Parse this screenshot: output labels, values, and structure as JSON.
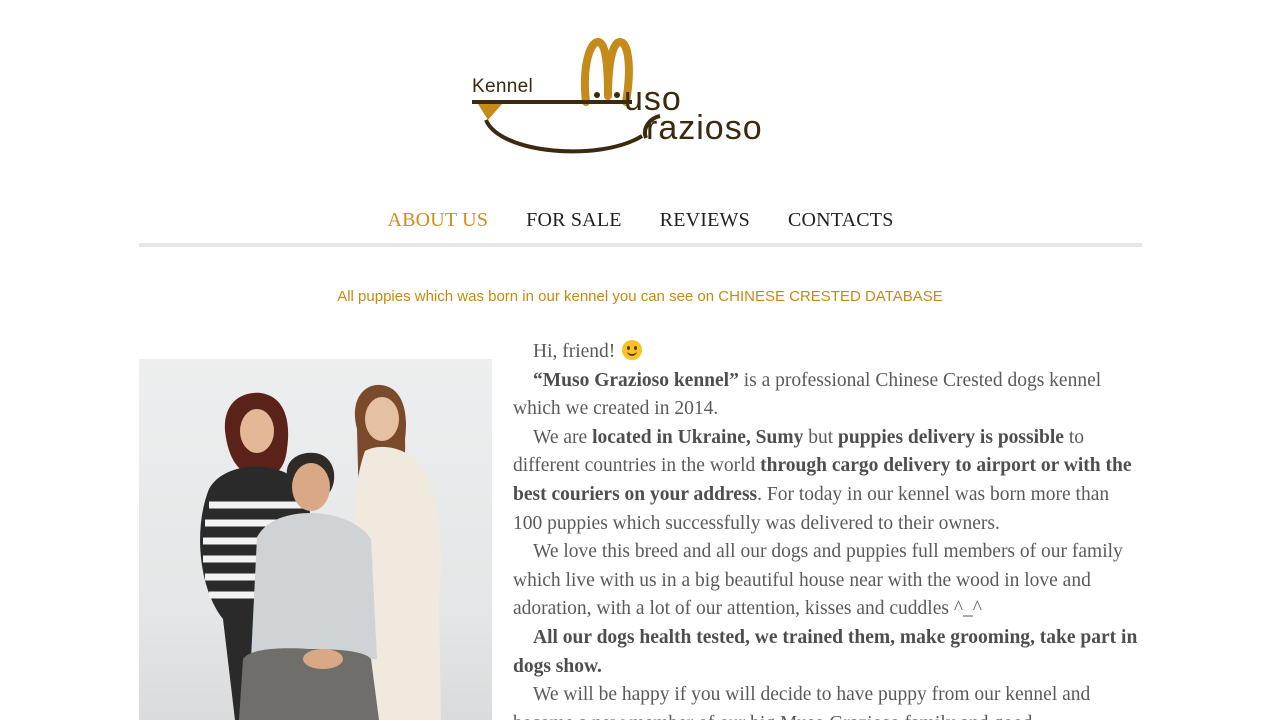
{
  "logo": {
    "kennel": "Kennel",
    "muso": "uso",
    "grazioso": "razioso"
  },
  "nav": {
    "items": [
      {
        "label": "ABOUT US",
        "active": true
      },
      {
        "label": "FOR SALE",
        "active": false
      },
      {
        "label": "REVIEWS",
        "active": false
      },
      {
        "label": "CONTACTS",
        "active": false
      }
    ]
  },
  "notice": {
    "text": "All puppies which was born in our kennel you can see on ",
    "link": "CHINESE CRESTED DATABASE"
  },
  "colors": {
    "accent": "#d38c17",
    "logo_brown": "#3a2a0e",
    "logo_gold": "#c48a1a",
    "body_text": "#5a5a5a"
  },
  "article": {
    "p1": "Hi, friend!",
    "p1_emoji": "slightly-smiling-face-icon",
    "p2_bold": "“Muso Grazioso kennel”",
    "p2_rest": " is a professional Chinese Crested dogs kennel which we created in 2014.",
    "p3_a": "We are ",
    "p3_b": "located in Ukraine, Sumy",
    "p3_c": " but ",
    "p3_d": "puppies delivery is possible",
    "p3_e": " to different countries in the world ",
    "p3_f": "through cargo delivery to airport or with the best couriers on your address",
    "p3_g": ". For today in our kennel was born more than 100 puppies which successfully was delivered to their owners.",
    "p4": "We love this breed and all our dogs and puppies full members of our family which live with us in a big beautiful house near with the wood in love and adoration, with a lot of our attention, kisses and cuddles ^_^",
    "p5_bold": "All our dogs health tested, we trained them, make grooming, take part in dogs show.",
    "p6": "We will be happy if you will decide to have puppy from our kennel and become a new member of our big Muso Grazioso family and good ..."
  }
}
